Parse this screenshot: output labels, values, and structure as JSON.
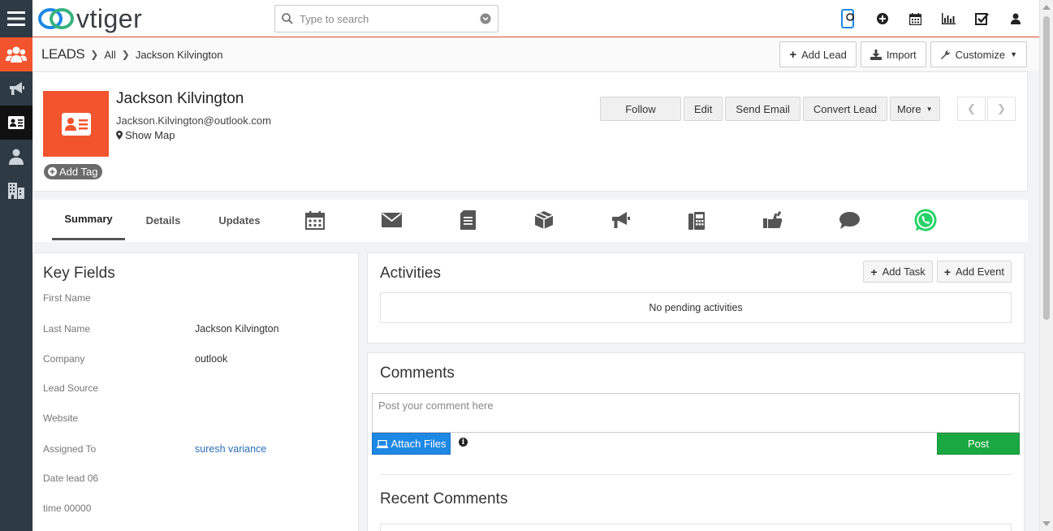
{
  "app": {
    "logo_text": "vtiger",
    "search_placeholder": "Type to search"
  },
  "top_icons": [
    "phone-signal-icon",
    "plus-circle-icon",
    "calendar-icon",
    "bar-chart-icon",
    "checkbox-icon",
    "user-icon"
  ],
  "left_nav": [
    "leads-group-icon",
    "campaigns-megaphone-icon",
    "contact-card-icon",
    "contacts-person-icon",
    "organizations-building-icon"
  ],
  "breadcrumb": {
    "module": "LEADS",
    "list": "All",
    "record": "Jackson Kilvington"
  },
  "toolbar": {
    "add_lead": "Add Lead",
    "import": "Import",
    "customize": "Customize"
  },
  "record": {
    "name": "Jackson Kilvington",
    "email": "Jackson.Kilvington@outlook.com",
    "show_map": "Show Map",
    "add_tag": "Add Tag"
  },
  "actions": {
    "follow": "Follow",
    "edit": "Edit",
    "send_email": "Send Email",
    "convert_lead": "Convert Lead",
    "more": "More"
  },
  "tabs": {
    "summary": "Summary",
    "details": "Details",
    "updates": "Updates"
  },
  "tab_icons": [
    "calendar-icon",
    "email-icon",
    "document-icon",
    "box-icon",
    "campaign-icon",
    "phone-icon",
    "hand-icon",
    "chat-icon",
    "whatsapp-icon"
  ],
  "key_fields": {
    "title": "Key Fields",
    "rows": [
      {
        "label": "First Name",
        "value": ""
      },
      {
        "label": "Last Name",
        "value": "Jackson Kilvington"
      },
      {
        "label": "Company",
        "value": "outlook"
      },
      {
        "label": "Lead Source",
        "value": ""
      },
      {
        "label": "Website",
        "value": ""
      },
      {
        "label": "Assigned To",
        "value": "suresh variance"
      },
      {
        "label": "Date lead 06",
        "value": ""
      },
      {
        "label": "time 00000",
        "value": ""
      }
    ]
  },
  "activities": {
    "title": "Activities",
    "add_task": "Add Task",
    "add_event": "Add Event",
    "empty": "No pending activities"
  },
  "comments": {
    "title": "Comments",
    "placeholder": "Post your comment here",
    "attach": "Attach Files",
    "info": "i",
    "post": "Post",
    "recent_title": "Recent Comments"
  },
  "colors": {
    "accent_orange": "#f2542e",
    "nav_dark": "#2e3a44",
    "link_blue": "#2a6ebb",
    "attach_blue": "#1e88e5",
    "post_green": "#1aa843",
    "whatsapp_green": "#25d366"
  }
}
